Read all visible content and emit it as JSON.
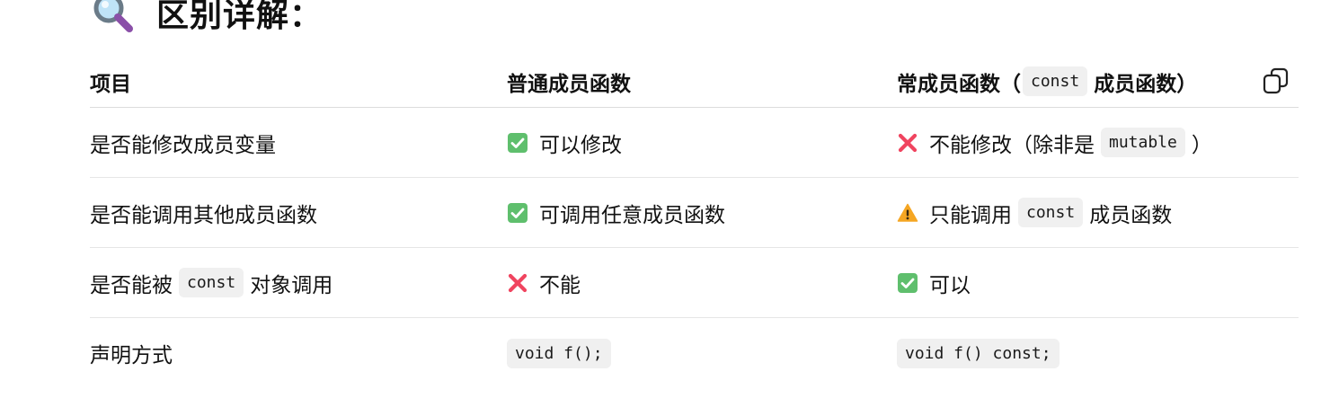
{
  "heading": {
    "text": "区别详解："
  },
  "table": {
    "headers": {
      "item": "项目",
      "normal": "普通成员函数",
      "const_prefix": "常成员函数（",
      "const_code": "const",
      "const_suffix": "成员函数）"
    },
    "rows": [
      {
        "item": "是否能修改成员变量",
        "normal_icon": "check-icon",
        "normal_text": "可以修改",
        "const_icon": "cross-icon",
        "const_text": "不能修改（除非是",
        "const_code": "mutable",
        "const_after": "）"
      },
      {
        "item": "是否能调用其他成员函数",
        "normal_icon": "check-icon",
        "normal_text": "可调用任意成员函数",
        "const_icon": "warning-icon",
        "const_text": "只能调用",
        "const_code": "const",
        "const_after": "成员函数"
      },
      {
        "item_prefix": "是否能被",
        "item_code": "const",
        "item_suffix": "对象调用",
        "normal_icon": "cross-icon",
        "normal_text": "不能",
        "const_icon": "check-icon",
        "const_text": "可以"
      },
      {
        "item": "声明方式",
        "normal_code": "void f();",
        "const_code": "void f() const;"
      }
    ]
  },
  "colors": {
    "check": "#5fbf6d",
    "cross": "#f0445f",
    "warning": "#f5a623",
    "code_bg": "#f0f0f0",
    "divider": "#e6e6e6"
  }
}
